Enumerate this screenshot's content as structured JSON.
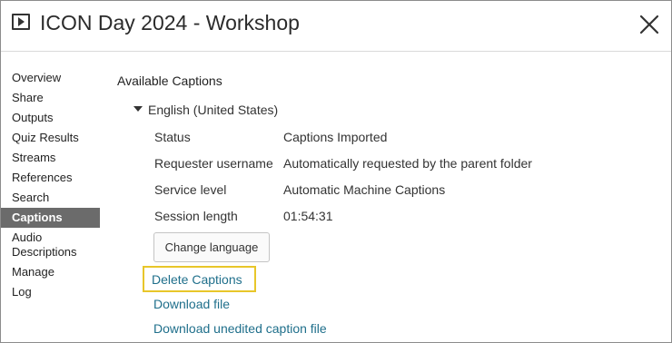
{
  "header": {
    "title": "ICON Day 2024 - Workshop"
  },
  "sidebar": {
    "items": [
      {
        "label": "Overview"
      },
      {
        "label": "Share"
      },
      {
        "label": "Outputs"
      },
      {
        "label": "Quiz Results"
      },
      {
        "label": "Streams"
      },
      {
        "label": "References"
      },
      {
        "label": "Search"
      },
      {
        "label": "Captions",
        "active": true
      },
      {
        "label": "Audio Descriptions"
      },
      {
        "label": "Manage"
      },
      {
        "label": "Log"
      }
    ]
  },
  "main": {
    "heading": "Available Captions",
    "language": "English (United States)",
    "details": [
      {
        "label": "Status",
        "value": "Captions Imported"
      },
      {
        "label": "Requester username",
        "value": "Automatically requested by the parent folder"
      },
      {
        "label": "Service level",
        "value": "Automatic Machine Captions"
      },
      {
        "label": "Session length",
        "value": "01:54:31"
      }
    ],
    "change_language_label": "Change language",
    "links": {
      "delete": "Delete Captions",
      "download": "Download file",
      "download_unedited": "Download unedited caption file"
    }
  },
  "colors": {
    "link": "#1f6f8b",
    "active_nav_bg": "#6b6b6b",
    "highlight_border": "#e8c62a"
  },
  "icons": {
    "title_icon": "play-icon",
    "close": "close-icon",
    "expand": "caret-down-icon"
  }
}
